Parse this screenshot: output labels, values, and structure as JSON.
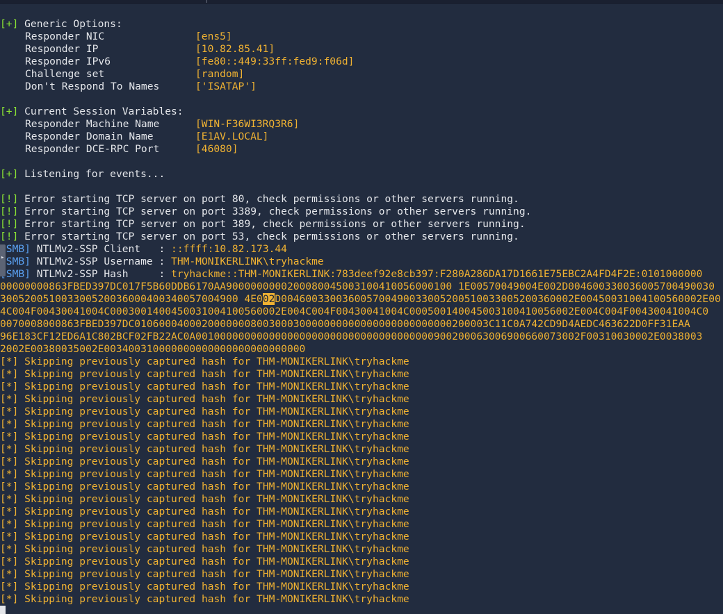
{
  "generic": {
    "tag": "[+]",
    "title": " Generic Options:",
    "rows": [
      {
        "label": "Responder NIC",
        "value": "[ens5]"
      },
      {
        "label": "Responder IP",
        "value": "[10.82.85.41]"
      },
      {
        "label": "Responder IPv6",
        "value": "[fe80::449:33ff:fed9:f06d]"
      },
      {
        "label": "Challenge set",
        "value": "[random]"
      },
      {
        "label": "Don't Respond To Names",
        "value": "['ISATAP']"
      }
    ]
  },
  "session": {
    "tag": "[+]",
    "title": " Current Session Variables:",
    "rows": [
      {
        "label": "Responder Machine Name",
        "value": "[WIN-F36WI3RQ3R6]"
      },
      {
        "label": "Responder Domain Name",
        "value": "[E1AV.LOCAL]"
      },
      {
        "label": "Responder DCE-RPC Port",
        "value": "[46080]"
      }
    ]
  },
  "listening": {
    "tag": "[+]",
    "text": " Listening for events..."
  },
  "errors": {
    "tag": "[!]",
    "lines": [
      " Error starting TCP server on port 80, check permissions or other servers running.",
      " Error starting TCP server on port 3389, check permissions or other servers running.",
      " Error starting TCP server on port 389, check permissions or other servers running.",
      " Error starting TCP server on port 53, check permissions or other servers running."
    ]
  },
  "smb": {
    "client": {
      "tag": "[SMB]",
      "label": " NTLMv2-SSP Client   : ",
      "value": "::ffff:10.82.173.44"
    },
    "username": {
      "tag": "[SMB]",
      "label": " NTLMv2-SSP Username : ",
      "value": "THM-MONIKERLINK\\tryhackme"
    },
    "hash": {
      "tag": "[SMB]",
      "label": " NTLMv2-SSP Hash     : ",
      "line1": "tryhackme::THM-MONIKERLINK:783deef92e8cb397:F280A286DA17D1661E75EBC2A4FD4F2E:0101000000",
      "line2": "00000000863FBED397DC017F5B60DDB6170AA9000000000200080045003100410056000100 1E00570049004E002D004600330036005700490030",
      "line3_pre": "300520051003300520036000400340057004900 4E0",
      "line3_hl": "02",
      "line3_post": "D004600330036005700490033005200510033005200360002E00450031004100560002E00",
      "line4": "4C004F00430041004C0003001400450031004100560002E004C004F00430041004C000500140045003100410056002E004C004F00430041004C0",
      "line5": "0070008000863FBED397DC0106000400020000000800300030000000000000000000000000200003C11C0A742CD9D4AEDC463622D0FF31EAA",
      "line6": "96E183CF12ED6A1C802BCF02FB22AC0A001000000000000000000000000000000000000900200063006900660073002F00310030002E0038003",
      "line7": "2002E00380035002E003400310000000000000000000000000"
    }
  },
  "skip": {
    "tag": "[*]",
    "text": " Skipping previously captured hash for ",
    "user": "THM-MONIKERLINK\\tryhackme",
    "count": 20
  }
}
